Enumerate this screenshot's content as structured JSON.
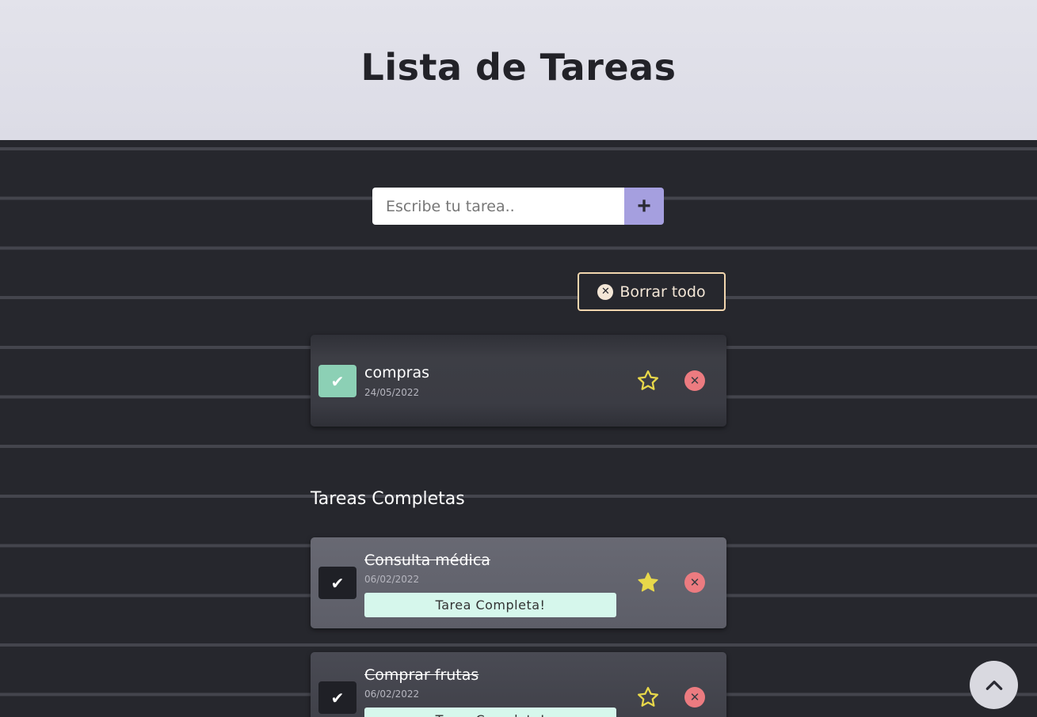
{
  "header": {
    "title": "Lista de Tareas"
  },
  "form": {
    "placeholder": "Escribe tu tarea..",
    "add_label": "+"
  },
  "clear_all": {
    "label": "Borrar todo",
    "icon": "x-circle-icon"
  },
  "pending_tasks": [
    {
      "title": "compras",
      "date": "24/05/2022",
      "favorite": false,
      "completed": false
    }
  ],
  "completed_section": {
    "title": "Tareas Completas"
  },
  "completed_tasks": [
    {
      "title": "Consulta médica",
      "date": "06/02/2022",
      "favorite": true,
      "badge": "Tarea Completa!"
    },
    {
      "title": "Comprar frutas",
      "date": "06/02/2022",
      "favorite": false,
      "badge": "Tarea Completa!"
    }
  ],
  "colors": {
    "accent_purple": "#a59fdf",
    "check_green": "#8cd0b5",
    "star_yellow": "#e8d84a",
    "delete_red": "#ec7b80",
    "badge_mint": "#d6f7ec",
    "border_peach": "#f2d6ae"
  }
}
